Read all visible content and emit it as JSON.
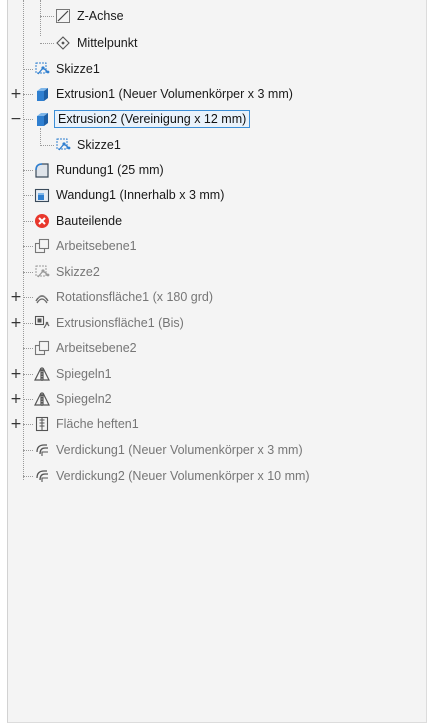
{
  "tree": {
    "items": [
      {
        "label": "Z-Achse",
        "icon": "axis-icon",
        "state": "normal"
      },
      {
        "label": "Mittelpunkt",
        "icon": "point-icon",
        "state": "normal"
      },
      {
        "label": "Skizze1",
        "icon": "sketch-icon",
        "state": "normal"
      },
      {
        "label": "Extrusion1 (Neuer Volumenkörper x 3 mm)",
        "icon": "extrusion-icon",
        "state": "collapsed"
      },
      {
        "label": "Extrusion2 (Vereinigung x 12 mm)",
        "icon": "extrusion-icon",
        "state": "expanded-selected"
      },
      {
        "label": "Skizze1",
        "icon": "sketch-icon",
        "state": "child"
      },
      {
        "label": "Rundung1 (25 mm)",
        "icon": "fillet-icon",
        "state": "normal"
      },
      {
        "label": "Wandung1 (Innerhalb x 3 mm)",
        "icon": "shell-icon",
        "state": "normal"
      },
      {
        "label": "Bauteilende",
        "icon": "end-of-part-icon",
        "state": "normal"
      },
      {
        "label": "Arbeitsebene1",
        "icon": "work-plane-icon",
        "state": "suppressed"
      },
      {
        "label": "Skizze2",
        "icon": "sketch-icon",
        "state": "suppressed"
      },
      {
        "label": "Rotationsfläche1 (x 180 grd)",
        "icon": "revolve-icon",
        "state": "suppressed-collapsed"
      },
      {
        "label": "Extrusionsfläche1 (Bis)",
        "icon": "extrude-surface-icon",
        "state": "suppressed-collapsed"
      },
      {
        "label": "Arbeitsebene2",
        "icon": "work-plane-icon",
        "state": "suppressed"
      },
      {
        "label": "Spiegeln1",
        "icon": "mirror-icon",
        "state": "suppressed-collapsed"
      },
      {
        "label": "Spiegeln2",
        "icon": "mirror-icon",
        "state": "suppressed-collapsed"
      },
      {
        "label": "Fläche heften1",
        "icon": "stitch-icon",
        "state": "suppressed-collapsed"
      },
      {
        "label": "Verdickung1 (Neuer Volumenkörper x 3 mm)",
        "icon": "thicken-icon",
        "state": "suppressed"
      },
      {
        "label": "Verdickung2 (Neuer Volumenkörper x 10 mm)",
        "icon": "thicken-icon",
        "state": "suppressed"
      }
    ]
  },
  "colors": {
    "panel_bg": "#f4f4f4",
    "selection_border": "#3c8fd8",
    "solid_blue": "#2f7fd0",
    "error_red": "#e8372c",
    "disabled_text": "#767676"
  }
}
